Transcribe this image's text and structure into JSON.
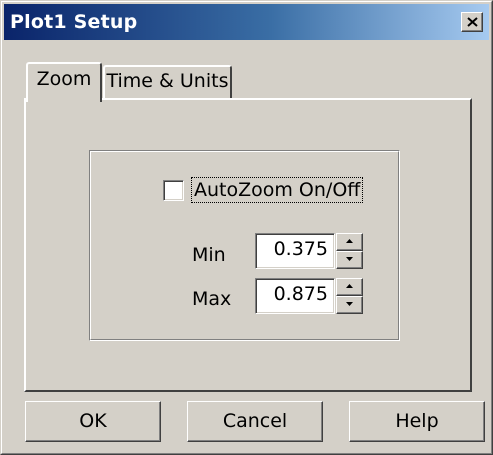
{
  "window": {
    "title": "Plot1 Setup"
  },
  "tabs": [
    {
      "label": "Zoom",
      "selected": true
    },
    {
      "label": "Time & Units",
      "selected": false
    }
  ],
  "zoom": {
    "autozoom_label": "AutoZoom On/Off",
    "autozoom_checked": false,
    "min_label": "Min",
    "min_value": "0.375",
    "max_label": "Max",
    "max_value": "0.875"
  },
  "buttons": {
    "ok": "OK",
    "cancel": "Cancel",
    "help": "Help"
  },
  "icons": {
    "close": "close-icon",
    "spin_up": "arrow-up-icon",
    "spin_down": "arrow-down-icon"
  },
  "colors": {
    "face": "#d4d0c8",
    "title_start": "#0a246a",
    "title_end": "#a6caf0"
  }
}
